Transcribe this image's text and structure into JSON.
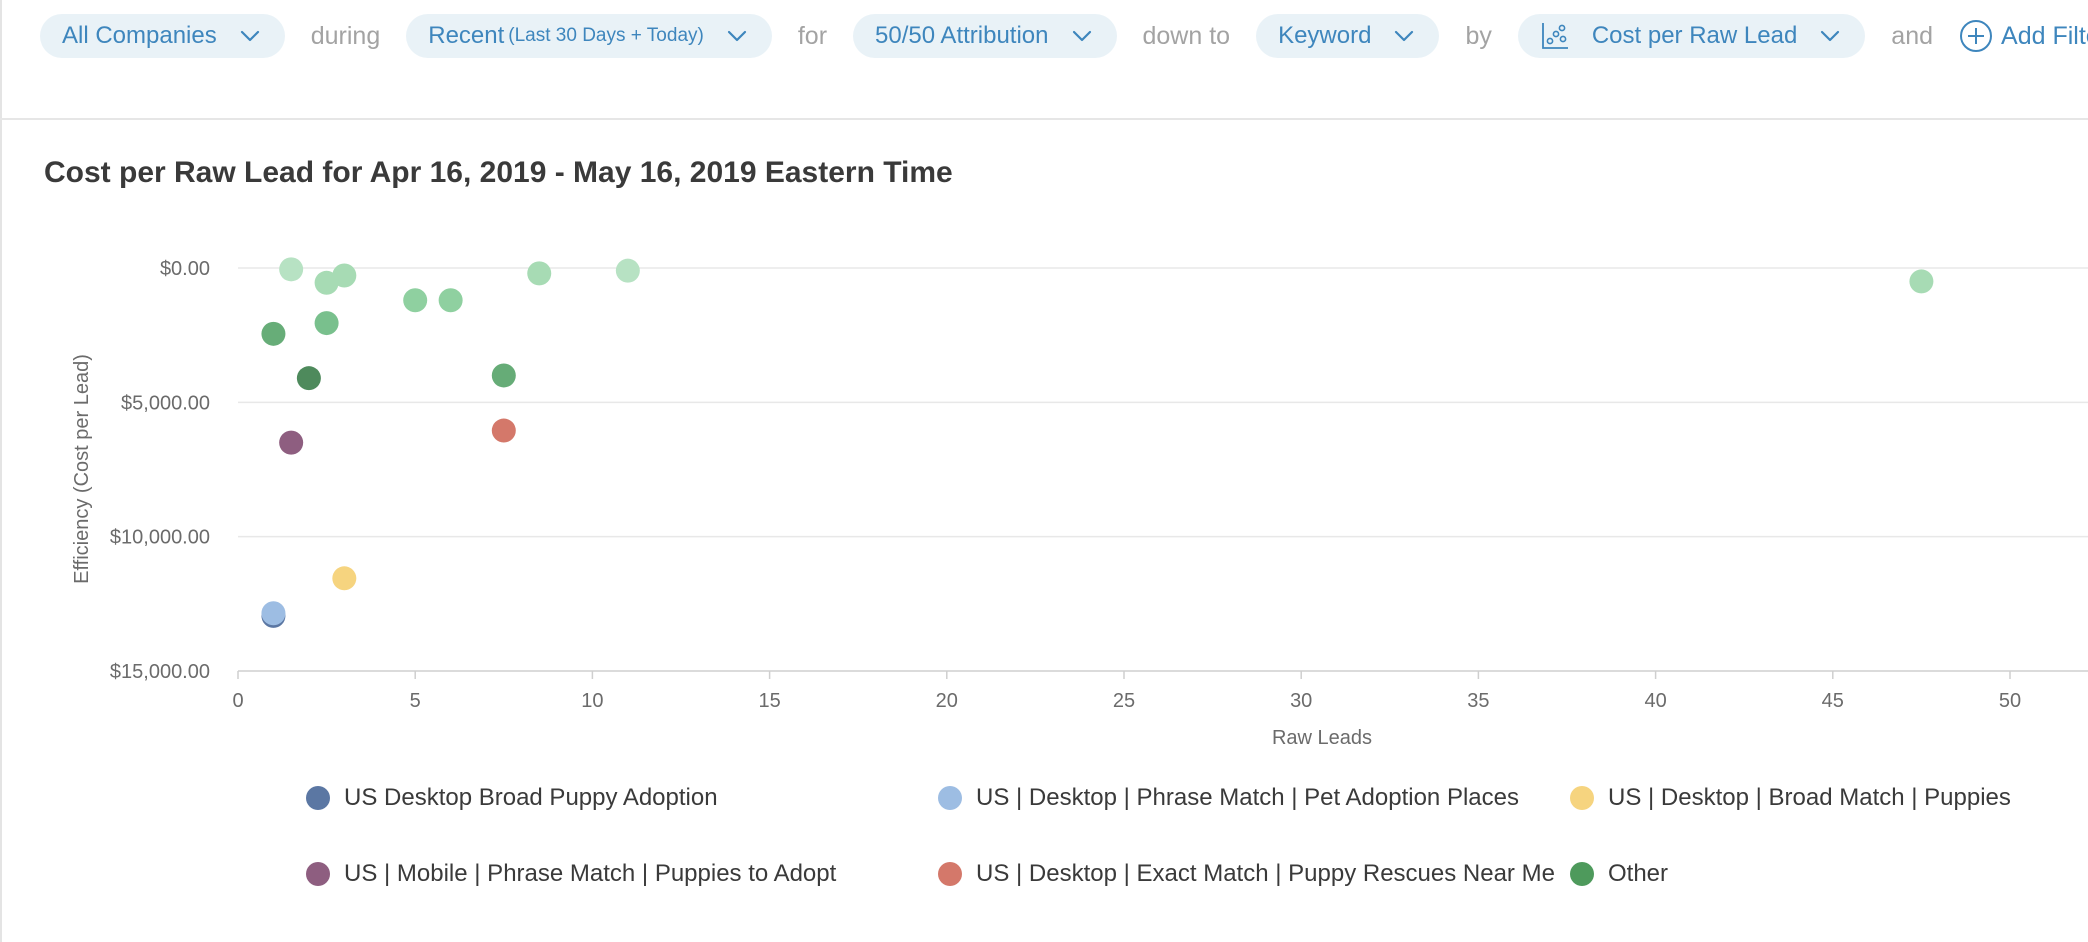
{
  "filters": {
    "company": "All Companies",
    "during_label": "during",
    "period": "Recent",
    "period_sub": "(Last 30 Days + Today)",
    "for_label": "for",
    "attribution": "50/50 Attribution",
    "down_to_label": "down to",
    "level": "Keyword",
    "by_label": "by",
    "metric": "Cost per Raw Lead",
    "and_label": "and",
    "add_filter": "Add Filter"
  },
  "icons": {
    "chevron": "chevron-down-icon",
    "scatter": "scatter-chart-icon",
    "plus": "plus-circle-icon"
  },
  "colors": {
    "accent": "#3e86bd",
    "pill_bg": "#e9f2f7"
  },
  "chart_data": {
    "type": "scatter",
    "title": "Cost per Raw Lead for Apr 16, 2019 - May 16, 2019 Eastern Time",
    "xlabel": "Raw Leads",
    "ylabel": "Efficiency (Cost per Lead)",
    "xlim": [
      0,
      52
    ],
    "ylim": [
      0,
      15000
    ],
    "y_inverted": true,
    "x_ticks": [
      "0",
      "5",
      "10",
      "15",
      "20",
      "25",
      "30",
      "35",
      "40",
      "45",
      "50"
    ],
    "x_tick_values": [
      0,
      5,
      10,
      15,
      20,
      25,
      30,
      35,
      40,
      45,
      50
    ],
    "y_ticks": [
      "$0.00",
      "$5,000.00",
      "$10,000.00",
      "$15,000.00"
    ],
    "y_tick_values": [
      0,
      5000,
      10000,
      15000
    ],
    "grid": true,
    "legend_position": "bottom",
    "series": [
      {
        "name": "US Desktop Broad Puppy Adoption",
        "color": "#5b77a3",
        "points": [
          {
            "x": 1,
            "y": 12950
          }
        ]
      },
      {
        "name": "US | Desktop | Phrase Match | Pet Adoption Places",
        "color": "#9dbde3",
        "points": [
          {
            "x": 1,
            "y": 12850
          }
        ]
      },
      {
        "name": "US | Desktop | Broad Match | Puppies",
        "color": "#f6d47f",
        "points": [
          {
            "x": 3,
            "y": 11550
          }
        ]
      },
      {
        "name": "US | Mobile | Phrase Match | Puppies to Adopt",
        "color": "#8e5e80",
        "points": [
          {
            "x": 1.5,
            "y": 6500
          }
        ]
      },
      {
        "name": "US | Desktop | Exact Match | Puppy Rescues Near Me",
        "color": "#d4786a",
        "points": [
          {
            "x": 7.5,
            "y": 6050
          }
        ]
      },
      {
        "name": "Other",
        "color": "#4e9a5c",
        "points": [
          {
            "x": 1.5,
            "y": 50,
            "shade": "#b7e2c3"
          },
          {
            "x": 2.5,
            "y": 550,
            "shade": "#a7dbb4"
          },
          {
            "x": 3,
            "y": 280,
            "shade": "#a7dbb4"
          },
          {
            "x": 8.5,
            "y": 200,
            "shade": "#a7dbb4"
          },
          {
            "x": 11,
            "y": 100,
            "shade": "#b7e2c3"
          },
          {
            "x": 47.5,
            "y": 500,
            "shade": "#a7dbb4"
          },
          {
            "x": 5,
            "y": 1200,
            "shade": "#8fd0a0"
          },
          {
            "x": 6,
            "y": 1200,
            "shade": "#8fd0a0"
          },
          {
            "x": 2.5,
            "y": 2050,
            "shade": "#79c08d"
          },
          {
            "x": 1,
            "y": 2450,
            "shade": "#67ad78"
          },
          {
            "x": 7.5,
            "y": 4000,
            "shade": "#66ac77"
          },
          {
            "x": 2,
            "y": 4100,
            "shade": "#4e8a5c"
          }
        ]
      }
    ]
  }
}
